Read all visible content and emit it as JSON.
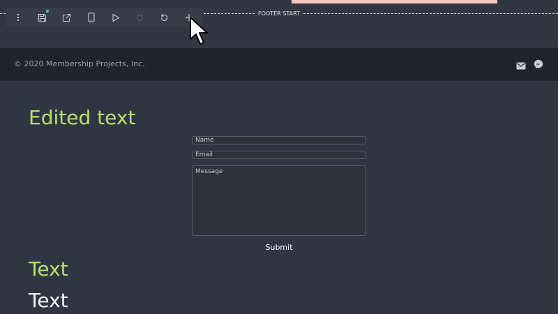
{
  "editor": {
    "footer_marker_label": "FOOTER START",
    "toolbar": {
      "buttons": [
        {
          "name": "more",
          "icon": "more-vertical-icon"
        },
        {
          "name": "save",
          "icon": "save-icon",
          "unsaved_indicator_color": "#4fc9b3"
        },
        {
          "name": "open-external",
          "icon": "external-link-icon"
        },
        {
          "name": "mobile-preview",
          "icon": "mobile-icon"
        },
        {
          "name": "preview",
          "icon": "play-icon"
        },
        {
          "name": "redo",
          "icon": "redo-icon",
          "disabled": true
        },
        {
          "name": "undo",
          "icon": "undo-icon"
        },
        {
          "name": "add",
          "icon": "plus-icon"
        }
      ]
    }
  },
  "footer": {
    "copyright": "© 2020 Membership Projects, Inc.",
    "social_icons": [
      "mail-icon",
      "messenger-icon"
    ]
  },
  "content": {
    "heading": "Edited text",
    "form": {
      "name_placeholder": "Name",
      "email_placeholder": "Email",
      "message_placeholder": "Message",
      "submit_label": "Submit"
    },
    "text_green": "Text",
    "text_white": "Text"
  },
  "colors": {
    "page_background": "#303641",
    "footer_background": "#1f232b",
    "accent_green": "#b9e06b",
    "banner_pink": "#f6c7bf"
  }
}
